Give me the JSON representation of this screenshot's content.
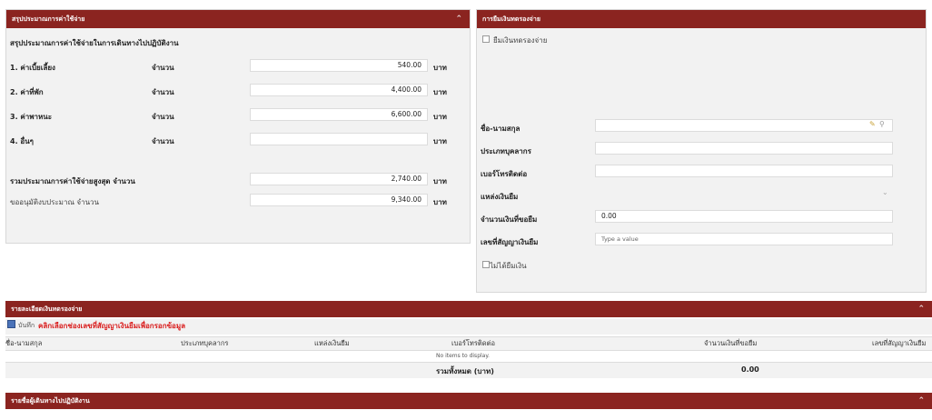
{
  "budget": {
    "header": "สรุปประมาณการค่าใช้จ่าย",
    "subtitle": "สรุปประมาณการค่าใช้จ่ายในการเดินทางไปปฏิบัติงาน",
    "qty_label": "จำนวน",
    "unit": "บาท",
    "rows": [
      {
        "label": "1. ค่าเบี้ยเลี้ยง",
        "value": "540.00"
      },
      {
        "label": "2. ค่าที่พัก",
        "value": "4,400.00"
      },
      {
        "label": "3. ค่าพาหนะ",
        "value": "6,600.00"
      },
      {
        "label": "4. อื่นๆ",
        "value": ""
      }
    ],
    "total_label": "รวมประมาณการค่าใช้จ่ายสูงสุด จำนวน",
    "total_value": "2,740.00",
    "approved_label": "ขออนุมัติงบประมาณ จำนวน",
    "approved_value": "9,340.00"
  },
  "advance": {
    "header": "การยืมเงินทดรองจ่าย",
    "checkbox_label": "ยืมเงินทดรองจ่าย",
    "fields": {
      "name_label": "ชื่อ-นามสกุล",
      "personnel_label": "ประเภทบุคลากร",
      "phone_label": "เบอร์โทรติดต่อ",
      "source_label": "แหล่งเงินยืม",
      "amount_label": "จำนวนเงินที่ขอยืม",
      "amount_value": "0.00",
      "contract_label": "เลขที่สัญญาเงินยืม",
      "contract_placeholder": "Type a value"
    },
    "no_borrow_label": "ไม่ได้ยืมเงิน"
  },
  "list": {
    "header": "รายละเอียดเงินทดรองจ่าย",
    "note_prefix": "บันทึก",
    "note": "คลิกเลือกช่องเลขที่สัญญาเงินยืมเพื่อกรอกข้อมูล",
    "columns": [
      "ชื่อ-นามสกุล",
      "ประเภทบุคลากร",
      "แหล่งเงินยืม",
      "เบอร์โทรติดต่อ",
      "จำนวนเงินที่ขอยืม",
      "เลขที่สัญญาเงินยืม"
    ],
    "empty": "No items to display.",
    "total_label": "รวมทั้งหมด (บาท)",
    "total_value": "0.00"
  },
  "bottom": {
    "header": "รายชื่อผู้เดินทางไปปฏิบัติงาน"
  }
}
